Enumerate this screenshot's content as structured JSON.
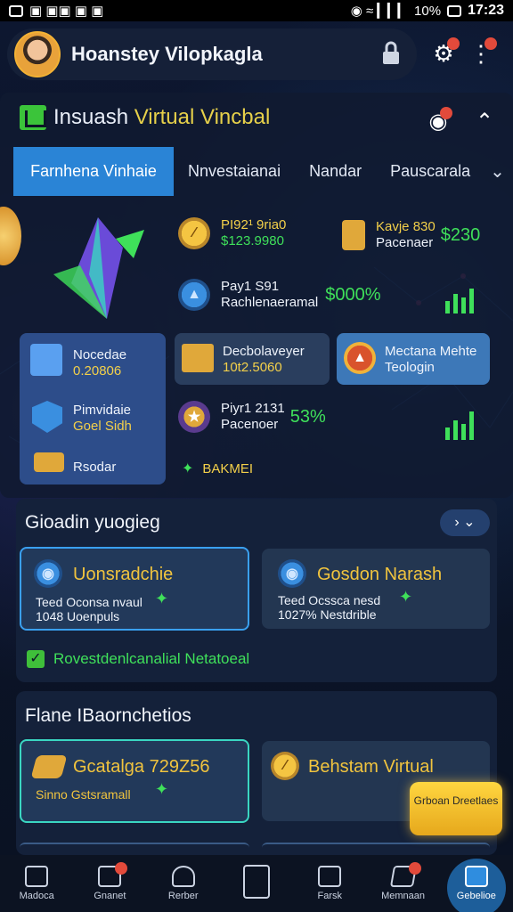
{
  "status_bar": {
    "left": "▣ ▣▣ ▣ ▣",
    "signal": "◉ ≈ ▎▎▎",
    "battery": "10%",
    "time": "17:23"
  },
  "header": {
    "user_name": "Hoanstey Vilopkagla"
  },
  "brand": {
    "name_plain": "Insuash",
    "name_accent": "Virtual Vincbal"
  },
  "tabs": [
    {
      "label": "Farnhena Vinhaie"
    },
    {
      "label": "Nnvestaianai"
    },
    {
      "label": "Nandar"
    },
    {
      "label": "Pauscarala"
    }
  ],
  "stats": {
    "s1": {
      "line1": "PI92¹ 9ria0",
      "line2": "$123.9980"
    },
    "s2": {
      "line1": "Kavje 830",
      "line2": "Pacenaer",
      "value": "$230"
    },
    "s3": {
      "line1": "Pay1 S91",
      "line2": "Rachlenaeramal",
      "value": "$000%"
    },
    "s4": {
      "line1": "Piyr1 2131",
      "line2": "Pacenoer",
      "value": "53%"
    },
    "s5": {
      "label": "BAKMEI"
    }
  },
  "cards": {
    "c1": {
      "title": "Nocedae",
      "value": "0.20806"
    },
    "c2": {
      "title": "Pimvidaie",
      "value": "Goel Sidh"
    },
    "c3": {
      "title": "Rsodar"
    },
    "c4": {
      "title": "Decbolaveyer",
      "value": "10t2.5060"
    },
    "c5": {
      "title": "Mectana Mehte",
      "value": "Teologin"
    }
  },
  "section1": {
    "title": "Gioadin yuogieg",
    "opt1": {
      "title": "Uonsradchie",
      "line1": "Teed  Oconsa nvaul",
      "line2": "1048  Uoenpuls"
    },
    "opt2": {
      "title": "Gosdon Narash",
      "line1": "Teed  Ocssca nesd",
      "line2": "1027%  Nestdrible"
    },
    "check_label": "Rovestdenlcanalial Netatoeal"
  },
  "section2": {
    "title": "Flane IBaornchetios",
    "opt1": {
      "title": "Gcatalga 729Z56",
      "line1": "Sinno Gstsramall"
    },
    "opt2": {
      "title": "Behstam Virtual"
    },
    "cta": "Grboan Dreetlaes"
  },
  "bottom_nav": [
    {
      "label": "Madoca"
    },
    {
      "label": "Gnanet"
    },
    {
      "label": "Rerber"
    },
    {
      "label": ""
    },
    {
      "label": "Farsk"
    },
    {
      "label": "Memnaan"
    },
    {
      "label": "Gebelioe"
    }
  ],
  "colors": {
    "accent_blue": "#2a84d6",
    "accent_gold": "#f3d04a",
    "accent_green": "#3fe05a",
    "background": "#0b1426"
  }
}
